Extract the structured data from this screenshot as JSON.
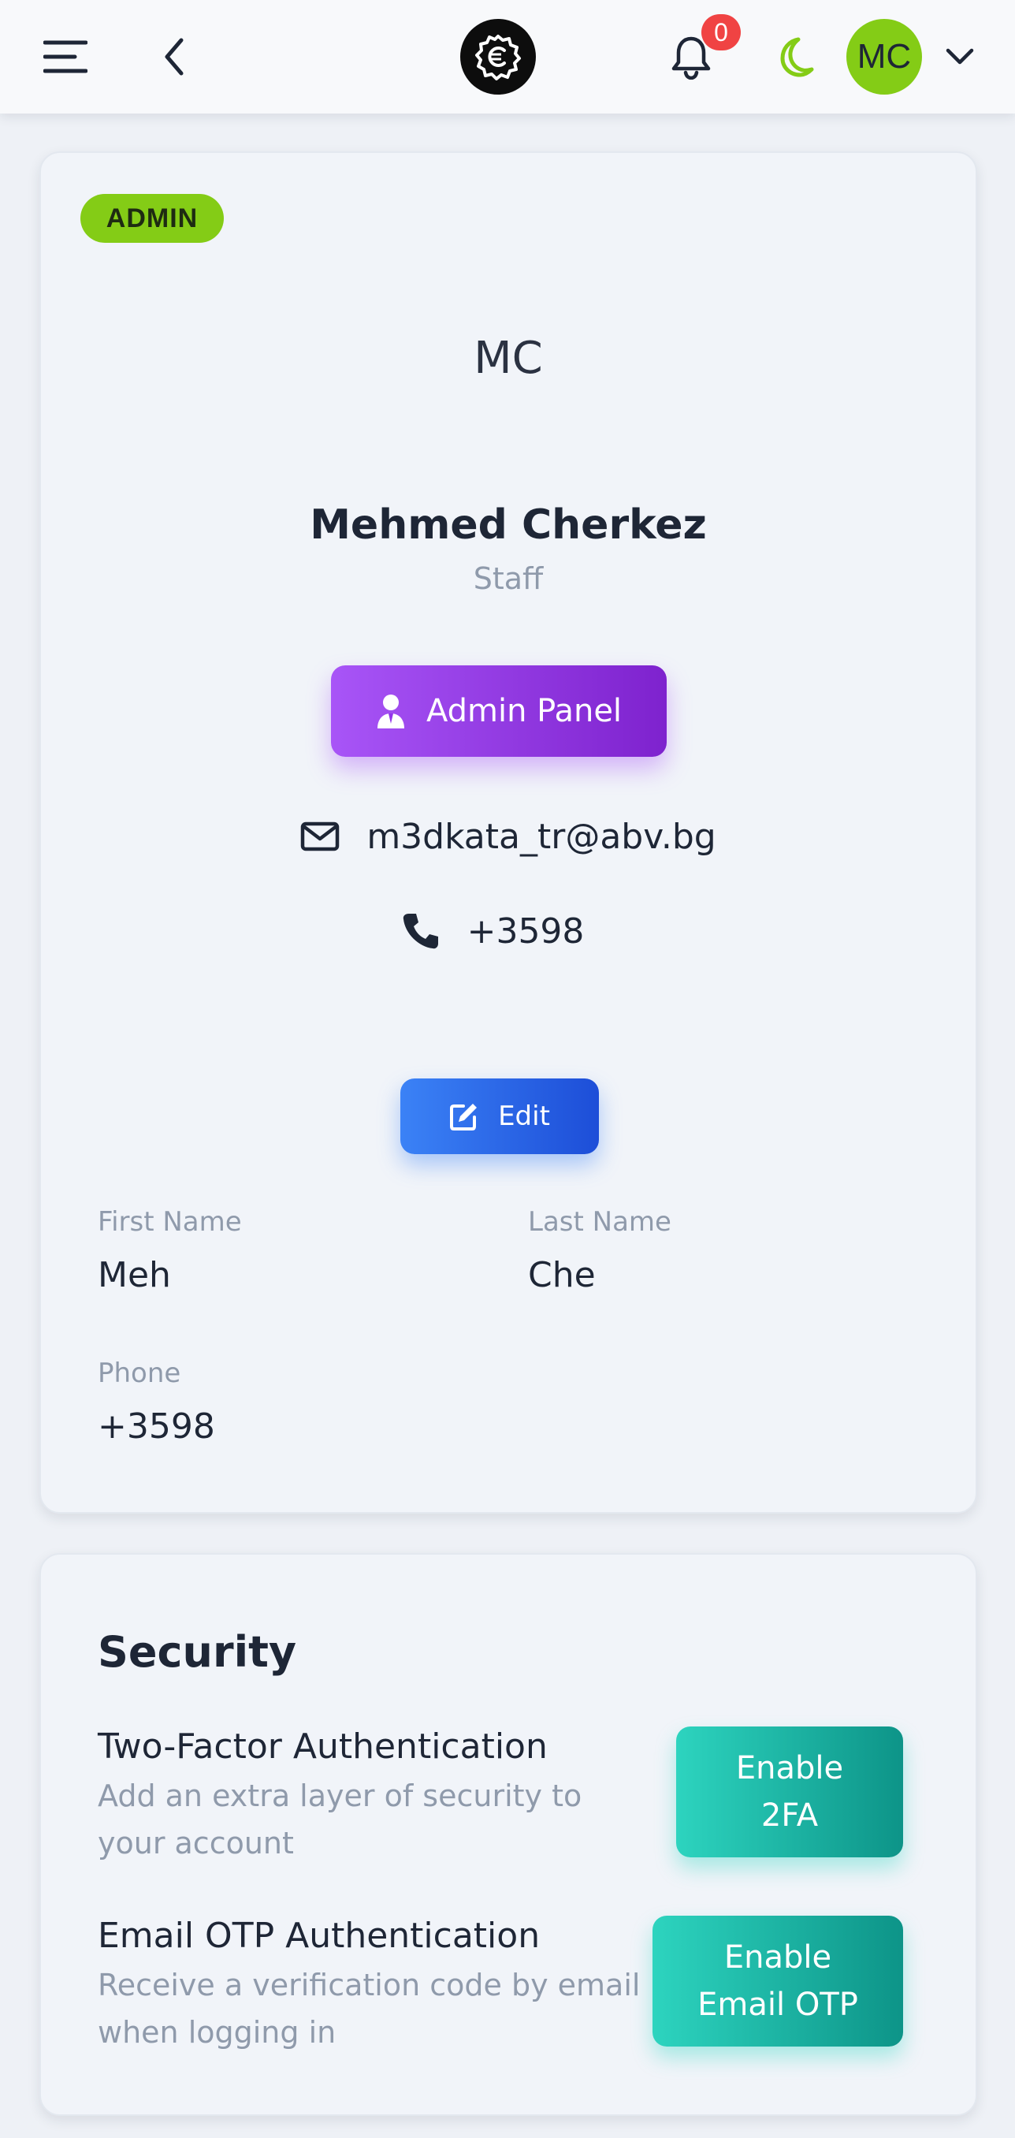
{
  "header": {
    "notification_count": "0",
    "user_initials": "MC",
    "accent_color": "#84cc16"
  },
  "profile": {
    "role_badge": "ADMIN",
    "initials": "MC",
    "full_name": "Mehmed Cherkez",
    "role": "Staff",
    "admin_panel_label": "Admin Panel",
    "email": "m3dkata_tr@abv.bg",
    "phone": "+3598",
    "edit_label": "Edit",
    "fields": {
      "first_name_label": "First Name",
      "first_name_value": "Meh",
      "last_name_label": "Last Name",
      "last_name_value": "Che",
      "phone_label": "Phone",
      "phone_value": "+3598"
    }
  },
  "security": {
    "title": "Security",
    "two_factor": {
      "title": "Two-Factor Authentication",
      "description": "Add an extra layer of security to your account",
      "button_line1": "Enable",
      "button_line2": "2FA"
    },
    "email_otp": {
      "title": "Email OTP Authentication",
      "description": "Receive a verification code by email when logging in",
      "button_line1": "Enable",
      "button_line2": "Email OTP"
    }
  },
  "icons": [
    "menu-icon",
    "back-icon",
    "logo-icon",
    "bell-icon",
    "moon-icon",
    "chevron-down-icon",
    "user-tie-icon",
    "envelope-icon",
    "phone-icon",
    "edit-icon"
  ]
}
